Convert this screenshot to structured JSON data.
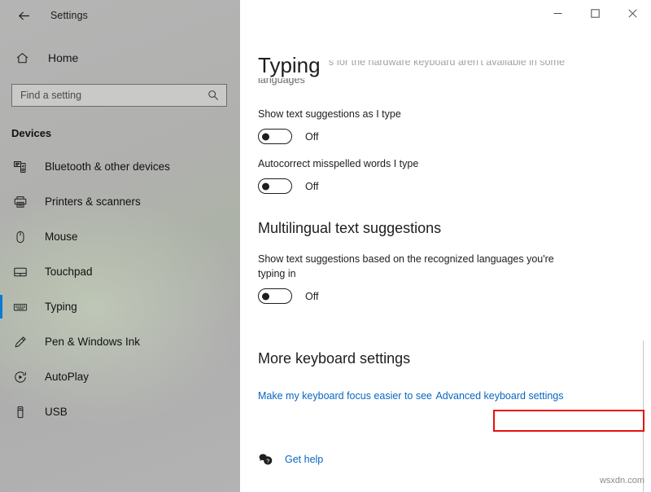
{
  "window": {
    "title": "Settings",
    "back_icon": "back-arrow-icon",
    "controls": {
      "minimize": "—",
      "maximize": "□",
      "close": "✕"
    }
  },
  "sidebar": {
    "home": {
      "label": "Home",
      "icon": "home-icon"
    },
    "search": {
      "placeholder": "Find a setting",
      "value": "",
      "icon": "search-icon"
    },
    "section": "Devices",
    "accent_color": "#0a7bd4",
    "items": [
      {
        "label": "Bluetooth & other devices",
        "icon": "bluetooth-devices-icon",
        "selected": false
      },
      {
        "label": "Printers & scanners",
        "icon": "printer-icon",
        "selected": false
      },
      {
        "label": "Mouse",
        "icon": "mouse-icon",
        "selected": false
      },
      {
        "label": "Touchpad",
        "icon": "touchpad-icon",
        "selected": false
      },
      {
        "label": "Typing",
        "icon": "keyboard-icon",
        "selected": true
      },
      {
        "label": "Pen & Windows Ink",
        "icon": "pen-icon",
        "selected": false
      },
      {
        "label": "AutoPlay",
        "icon": "autoplay-icon",
        "selected": false
      },
      {
        "label": "USB",
        "icon": "usb-icon",
        "selected": false
      }
    ]
  },
  "main": {
    "page_title": "Typing",
    "clipped_note": {
      "line1": "Text suggestions for the hardware keyboard aren't available in some",
      "line2": "languages"
    },
    "settings": [
      {
        "label": "Show text suggestions as I type",
        "toggle_state": "Off",
        "toggle_on": false
      },
      {
        "label": "Autocorrect misspelled words I type",
        "toggle_state": "Off",
        "toggle_on": false
      }
    ],
    "multilingual": {
      "heading": "Multilingual text suggestions",
      "description_line1": "Show text suggestions based on the recognized languages you're",
      "description_line2": "typing in",
      "toggle_state": "Off",
      "toggle_on": false
    },
    "more_keyboard": {
      "heading": "More keyboard settings",
      "links": [
        {
          "label": "Make my keyboard focus easier to see",
          "highlighted": false
        },
        {
          "label": "Advanced keyboard settings",
          "highlighted": true
        }
      ]
    },
    "get_help": {
      "label": "Get help",
      "icon": "help-bubble-icon"
    },
    "highlight_color": "#e61010"
  },
  "watermark": "wsxdn.com"
}
